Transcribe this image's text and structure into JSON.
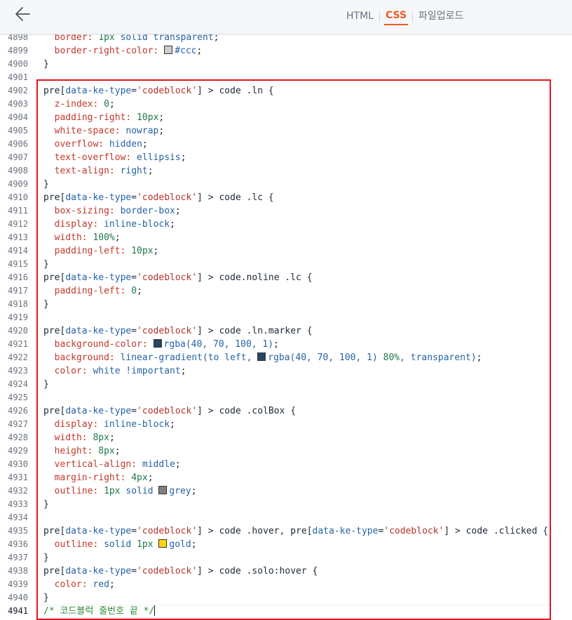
{
  "header": {
    "back_icon": "arrow-left-icon",
    "tabs": [
      {
        "label": "HTML",
        "active": false
      },
      {
        "label": "CSS",
        "active": true
      },
      {
        "label": "파일업로드",
        "active": false
      }
    ],
    "accent_color": "#ef5a24"
  },
  "editor": {
    "highlight_color": "#e3141e",
    "lines": [
      {
        "n": "4898",
        "t": "  border: 1px solid transparent;"
      },
      {
        "n": "4899",
        "t": "  border-right-color: #ccc;"
      },
      {
        "n": "4900",
        "t": "}"
      },
      {
        "n": "4901",
        "t": ""
      },
      {
        "n": "4902",
        "t": "pre[data-ke-type='codeblock'] > code .ln {"
      },
      {
        "n": "4903",
        "t": "  z-index: 0;"
      },
      {
        "n": "4904",
        "t": "  padding-right: 10px;"
      },
      {
        "n": "4905",
        "t": "  white-space: nowrap;"
      },
      {
        "n": "4906",
        "t": "  overflow: hidden;"
      },
      {
        "n": "4907",
        "t": "  text-overflow: ellipsis;"
      },
      {
        "n": "4908",
        "t": "  text-align: right;"
      },
      {
        "n": "4909",
        "t": "}"
      },
      {
        "n": "4910",
        "t": "pre[data-ke-type='codeblock'] > code .lc {"
      },
      {
        "n": "4911",
        "t": "  box-sizing: border-box;"
      },
      {
        "n": "4912",
        "t": "  display: inline-block;"
      },
      {
        "n": "4913",
        "t": "  width: 100%;"
      },
      {
        "n": "4914",
        "t": "  padding-left: 10px;"
      },
      {
        "n": "4915",
        "t": "}"
      },
      {
        "n": "4916",
        "t": "pre[data-ke-type='codeblock'] > code.noline .lc {"
      },
      {
        "n": "4917",
        "t": "  padding-left: 0;"
      },
      {
        "n": "4918",
        "t": "}"
      },
      {
        "n": "4919",
        "t": ""
      },
      {
        "n": "4920",
        "t": "pre[data-ke-type='codeblock'] > code .ln.marker {"
      },
      {
        "n": "4921",
        "t": "  background-color: rgba(40, 70, 100, 1);"
      },
      {
        "n": "4922",
        "t": "  background: linear-gradient(to left, rgba(40, 70, 100, 1) 80%, transparent);"
      },
      {
        "n": "4923",
        "t": "  color: white !important;"
      },
      {
        "n": "4924",
        "t": "}"
      },
      {
        "n": "4925",
        "t": ""
      },
      {
        "n": "4926",
        "t": "pre[data-ke-type='codeblock'] > code .colBox {"
      },
      {
        "n": "4927",
        "t": "  display: inline-block;"
      },
      {
        "n": "4928",
        "t": "  width: 8px;"
      },
      {
        "n": "4929",
        "t": "  height: 8px;"
      },
      {
        "n": "4930",
        "t": "  vertical-align: middle;"
      },
      {
        "n": "4931",
        "t": "  margin-right: 4px;"
      },
      {
        "n": "4932",
        "t": "  outline: 1px solid grey;"
      },
      {
        "n": "4933",
        "t": "}"
      },
      {
        "n": "4934",
        "t": ""
      },
      {
        "n": "4935",
        "t": "pre[data-ke-type='codeblock'] > code .hover, pre[data-ke-type='codeblock'] > code .clicked {"
      },
      {
        "n": "4936",
        "t": "  outline: solid 1px gold;"
      },
      {
        "n": "4937",
        "t": "}"
      },
      {
        "n": "4938",
        "t": "pre[data-ke-type='codeblock'] > code .solo:hover {"
      },
      {
        "n": "4939",
        "t": "  color: red;"
      },
      {
        "n": "4940",
        "t": "}"
      },
      {
        "n": "4941",
        "t": "/* 코드블럭 줄번호 끝 */"
      }
    ],
    "swatches": {
      "#ccc": "#cccccc",
      "rgba(40, 70, 100, 1)": "#284664",
      "white": "#ffffff",
      "grey": "#808080",
      "gold": "#ffd700",
      "red": "#ff0000"
    },
    "current_line": "4941"
  }
}
